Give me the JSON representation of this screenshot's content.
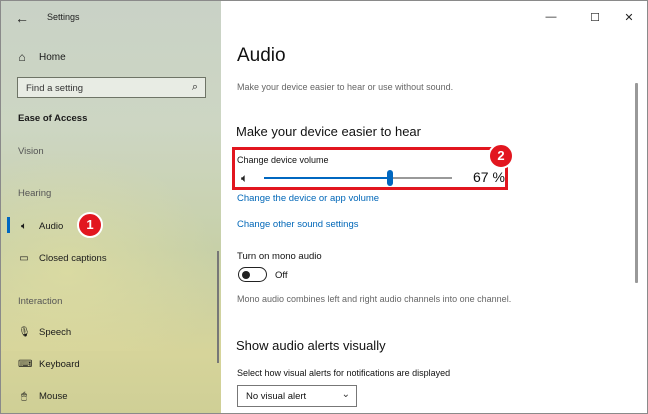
{
  "window": {
    "title": "Settings",
    "back_glyph": "←",
    "minimize_glyph": "—",
    "maximize_glyph": "☐",
    "close_glyph": "✕"
  },
  "sidebar": {
    "home": {
      "label": "Home",
      "icon": "home-icon",
      "glyph": "⌂"
    },
    "search": {
      "placeholder": "Find a setting",
      "icon": "search-icon",
      "glyph": "⌕"
    },
    "section_title": "Ease of Access",
    "groups": {
      "vision": "Vision",
      "hearing": "Hearing",
      "interaction": "Interaction"
    },
    "items": [
      {
        "label": "Audio",
        "icon": "speaker-icon",
        "glyph": "🔈︎",
        "active": true
      },
      {
        "label": "Closed captions",
        "icon": "captions-icon",
        "glyph": "▭"
      },
      {
        "label": "Speech",
        "icon": "microphone-icon",
        "glyph": "🎙︎"
      },
      {
        "label": "Keyboard",
        "icon": "keyboard-icon",
        "glyph": "⌨"
      },
      {
        "label": "Mouse",
        "icon": "mouse-icon",
        "glyph": "🖱︎"
      }
    ]
  },
  "annotations": {
    "badge1": "1",
    "badge2": "2",
    "color": "#e2161f"
  },
  "content": {
    "title": "Audio",
    "description": "Make your device easier to hear or use without sound.",
    "section1_title": "Make your device easier to hear",
    "volume": {
      "label": "Change device volume",
      "value": 67,
      "value_text": "67 %",
      "icon": "speaker-icon",
      "glyph": "🔈︎"
    },
    "link_app_volume": "Change the device or app volume",
    "link_other_sound": "Change other sound settings",
    "mono": {
      "label": "Turn on mono audio",
      "state": "Off",
      "on": false,
      "description": "Mono audio combines left and right audio channels into one channel."
    },
    "section2_title": "Show audio alerts visually",
    "alerts": {
      "label": "Select how visual alerts for notifications are displayed",
      "selected": "No visual alert",
      "chevron": "⌄"
    }
  },
  "colors": {
    "accent": "#0067c0",
    "link": "#0067b8",
    "highlight": "#e2161f"
  }
}
